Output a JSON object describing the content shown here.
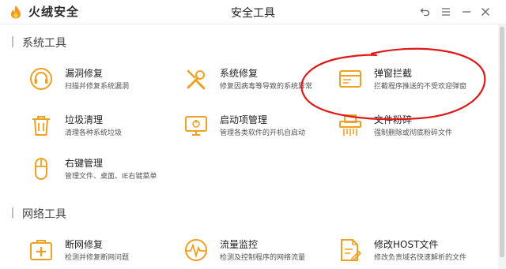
{
  "app": {
    "name": "火绒安全",
    "window_title": "安全工具"
  },
  "colors": {
    "accent": "#f0a020",
    "annotation": "#e01818"
  },
  "window_controls": [
    {
      "name": "back-icon"
    },
    {
      "name": "menu-icon"
    },
    {
      "name": "minimize-icon"
    },
    {
      "name": "close-icon"
    }
  ],
  "sections": {
    "system": {
      "title": "系统工具",
      "tools": [
        {
          "name": "漏洞修复",
          "desc": "扫描并修复系统漏洞",
          "icon": "headset-icon"
        },
        {
          "name": "系统修复",
          "desc": "修复因病毒等导致的系统异常",
          "icon": "wrench-icon"
        },
        {
          "name": "弹窗拦截",
          "desc": "拦截程序推送的不受欢迎弹窗",
          "icon": "window-icon"
        },
        {
          "name": "垃圾清理",
          "desc": "清理各种系统垃圾",
          "icon": "trash-icon"
        },
        {
          "name": "启动项管理",
          "desc": "管理各类软件的开机自启动",
          "icon": "monitor-icon"
        },
        {
          "name": "文件粉碎",
          "desc": "强制删除或彻底粉碎文件",
          "icon": "shredder-icon"
        },
        {
          "name": "右键管理",
          "desc": "管理文件、桌面、IE右键菜单",
          "icon": "mouse-icon"
        }
      ]
    },
    "network": {
      "title": "网络工具",
      "tools": [
        {
          "name": "断网修复",
          "desc": "检测并修复断网问题",
          "icon": "first-aid-icon"
        },
        {
          "name": "流量监控",
          "desc": "检测及控制程序的网络流量",
          "icon": "traffic-wave-icon"
        },
        {
          "name": "修改HOST文件",
          "desc": "修改负责域名快速解析的文件",
          "icon": "host-file-icon"
        }
      ]
    }
  }
}
